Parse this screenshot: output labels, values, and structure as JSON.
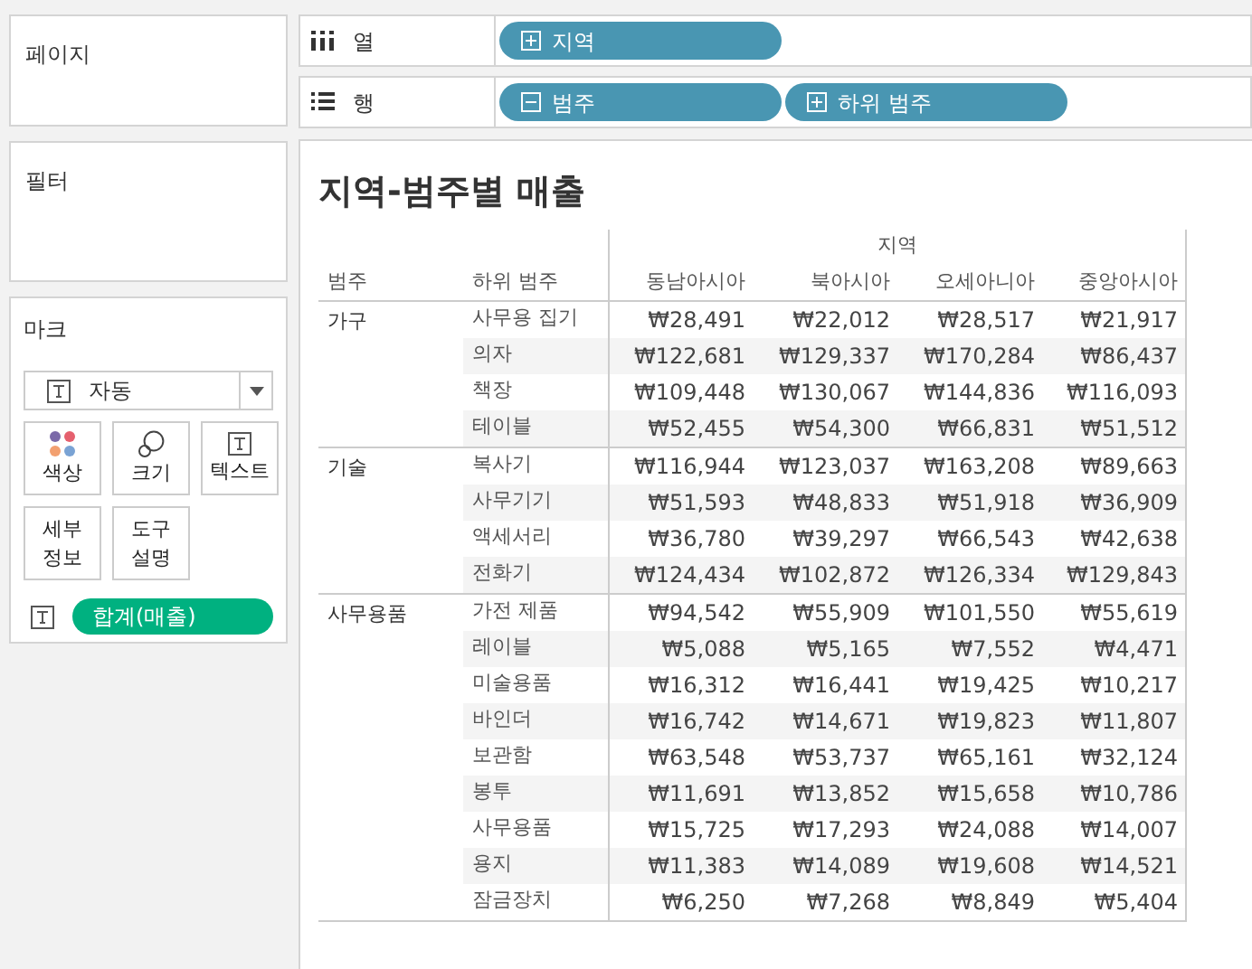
{
  "pages_card": {
    "title": "페이지"
  },
  "columns_shelf": {
    "label": "열",
    "pills": [
      {
        "label": "지역",
        "kind": "expand"
      }
    ]
  },
  "rows_shelf": {
    "label": "행",
    "pills": [
      {
        "label": "범주",
        "kind": "collapse"
      },
      {
        "label": "하위 범주",
        "kind": "expand"
      }
    ]
  },
  "filters_card": {
    "title": "필터"
  },
  "marks_card": {
    "title": "마크",
    "mark_type": "자동",
    "buttons": [
      {
        "lines": [
          "색상"
        ],
        "kind": "color"
      },
      {
        "lines": [
          "크기"
        ],
        "kind": "size"
      },
      {
        "lines": [
          "텍스트"
        ],
        "kind": "text"
      },
      {
        "lines": [
          "세부",
          "정보"
        ],
        "kind": "detail"
      },
      {
        "lines": [
          "도구",
          "설명"
        ],
        "kind": "tooltip"
      }
    ],
    "fields": [
      {
        "label": "합계(매출)",
        "kind": "text"
      }
    ]
  },
  "view": {
    "title": "지역-범주별 매출",
    "column_group": "지역",
    "headers": [
      "범주",
      "하위 범주",
      "동남아시아",
      "북아시아",
      "오세아니아",
      "중앙아시아"
    ],
    "groups": [
      {
        "category": "가구",
        "rows": [
          {
            "subcategory": "사무용 집기",
            "values": [
              "₩28,491",
              "₩22,012",
              "₩28,517",
              "₩21,917"
            ]
          },
          {
            "subcategory": "의자",
            "values": [
              "₩122,681",
              "₩129,337",
              "₩170,284",
              "₩86,437"
            ]
          },
          {
            "subcategory": "책장",
            "values": [
              "₩109,448",
              "₩130,067",
              "₩144,836",
              "₩116,093"
            ]
          },
          {
            "subcategory": "테이블",
            "values": [
              "₩52,455",
              "₩54,300",
              "₩66,831",
              "₩51,512"
            ]
          }
        ]
      },
      {
        "category": "기술",
        "rows": [
          {
            "subcategory": "복사기",
            "values": [
              "₩116,944",
              "₩123,037",
              "₩163,208",
              "₩89,663"
            ]
          },
          {
            "subcategory": "사무기기",
            "values": [
              "₩51,593",
              "₩48,833",
              "₩51,918",
              "₩36,909"
            ]
          },
          {
            "subcategory": "액세서리",
            "values": [
              "₩36,780",
              "₩39,297",
              "₩66,543",
              "₩42,638"
            ]
          },
          {
            "subcategory": "전화기",
            "values": [
              "₩124,434",
              "₩102,872",
              "₩126,334",
              "₩129,843"
            ]
          }
        ]
      },
      {
        "category": "사무용품",
        "rows": [
          {
            "subcategory": "가전 제품",
            "values": [
              "₩94,542",
              "₩55,909",
              "₩101,550",
              "₩55,619"
            ]
          },
          {
            "subcategory": "레이블",
            "values": [
              "₩5,088",
              "₩5,165",
              "₩7,552",
              "₩4,471"
            ]
          },
          {
            "subcategory": "미술용품",
            "values": [
              "₩16,312",
              "₩16,441",
              "₩19,425",
              "₩10,217"
            ]
          },
          {
            "subcategory": "바인더",
            "values": [
              "₩16,742",
              "₩14,671",
              "₩19,823",
              "₩11,807"
            ]
          },
          {
            "subcategory": "보관함",
            "values": [
              "₩63,548",
              "₩53,737",
              "₩65,161",
              "₩32,124"
            ]
          },
          {
            "subcategory": "봉투",
            "values": [
              "₩11,691",
              "₩13,852",
              "₩15,658",
              "₩10,786"
            ]
          },
          {
            "subcategory": "사무용품",
            "values": [
              "₩15,725",
              "₩17,293",
              "₩24,088",
              "₩14,007"
            ]
          },
          {
            "subcategory": "용지",
            "values": [
              "₩11,383",
              "₩14,089",
              "₩19,608",
              "₩14,521"
            ]
          },
          {
            "subcategory": "잠금장치",
            "values": [
              "₩6,250",
              "₩7,268",
              "₩8,849",
              "₩5,404"
            ]
          }
        ]
      }
    ]
  }
}
